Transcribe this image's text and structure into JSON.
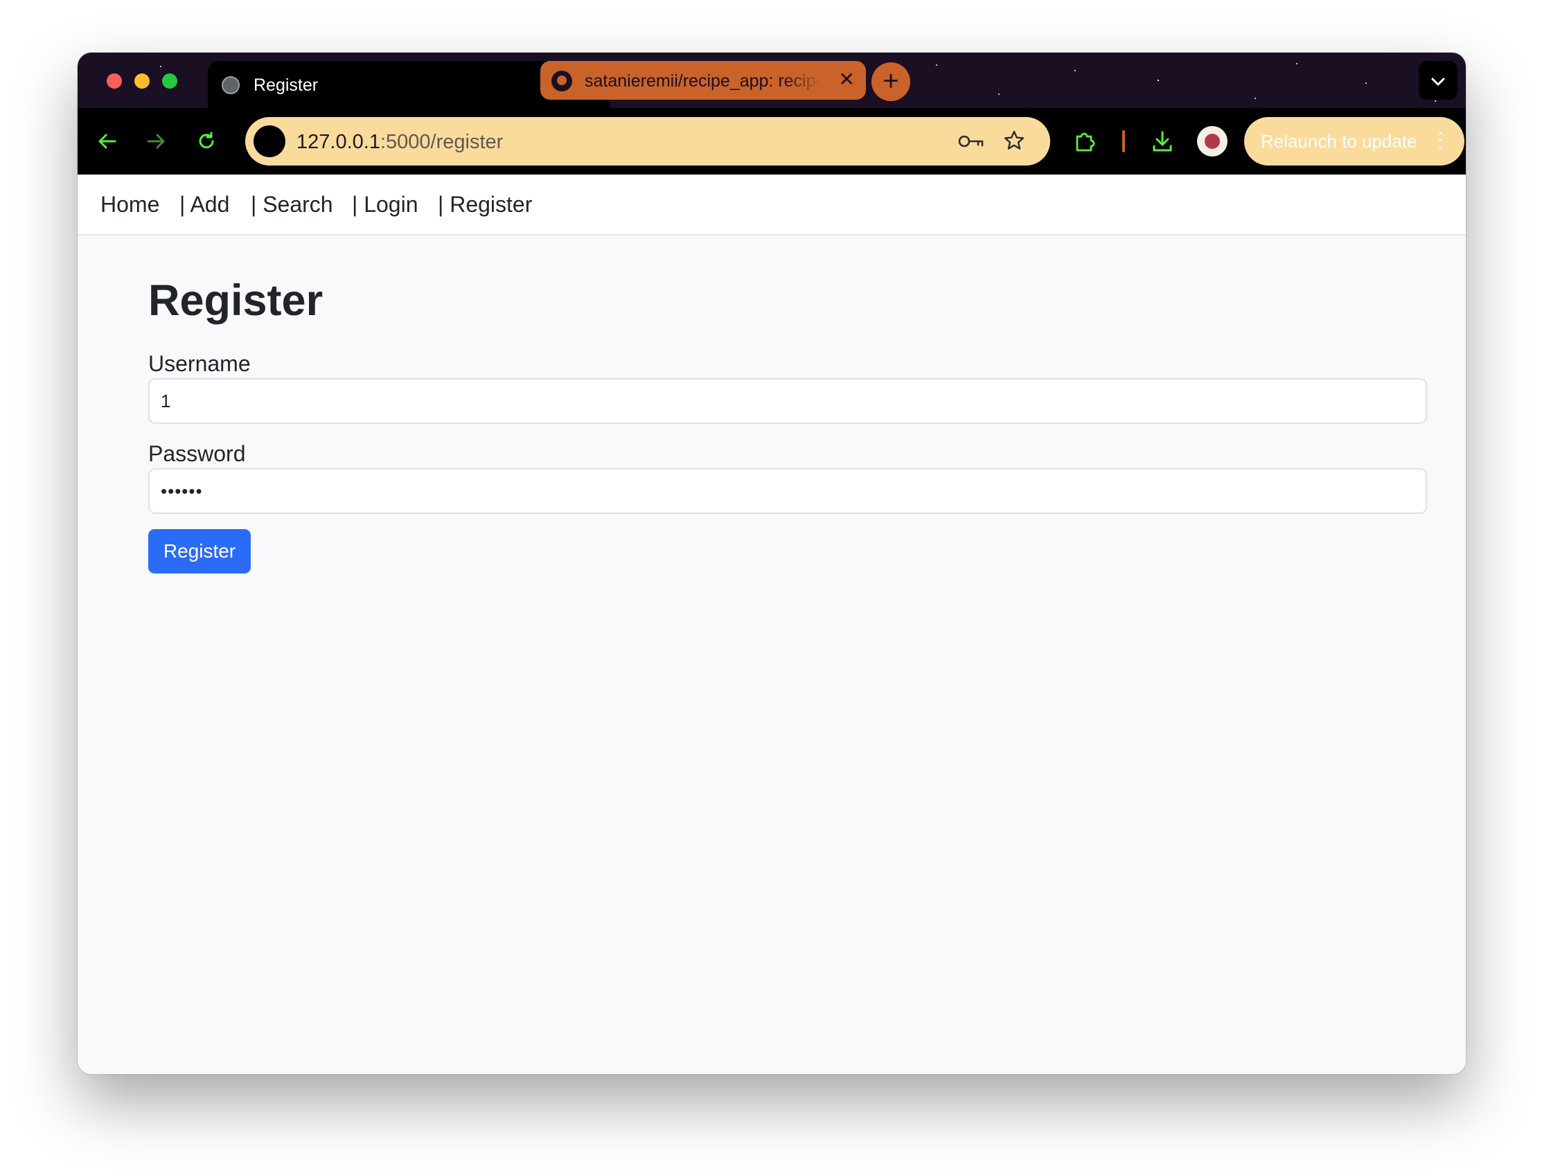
{
  "browser": {
    "tabs": [
      {
        "title": "Register",
        "active": true
      },
      {
        "title": "satanieremii/recipe_app: recipe",
        "active": false
      }
    ],
    "new_tab_symbol": "+",
    "close_symbol": "✕",
    "tab_menu_symbol": "⌄",
    "address_bar": {
      "host": "127.0.0.1",
      "path": ":5000/register"
    },
    "relaunch_label": "Relaunch to update",
    "icons": {
      "back": "arrow-left-icon",
      "forward": "arrow-right-icon",
      "reload": "reload-icon",
      "password": "key-icon",
      "bookmark": "star-icon",
      "extensions": "puzzle-icon",
      "downloads": "download-icon",
      "menu": "kebab-icon"
    },
    "theme_colors": {
      "tabstrip": "#1b0f24",
      "accent_green": "#59ee3a",
      "accent_orange": "#c9632a",
      "omnibox": "#fadb9c"
    }
  },
  "nav": {
    "home": "Home",
    "add": "| Add",
    "search": "| Search",
    "login": "| Login",
    "register": "| Register"
  },
  "form": {
    "title": "Register",
    "username_label": "Username",
    "username_value": "1",
    "password_label": "Password",
    "password_value": "••••••",
    "submit_label": "Register",
    "submit_color": "#2a6cf6"
  }
}
